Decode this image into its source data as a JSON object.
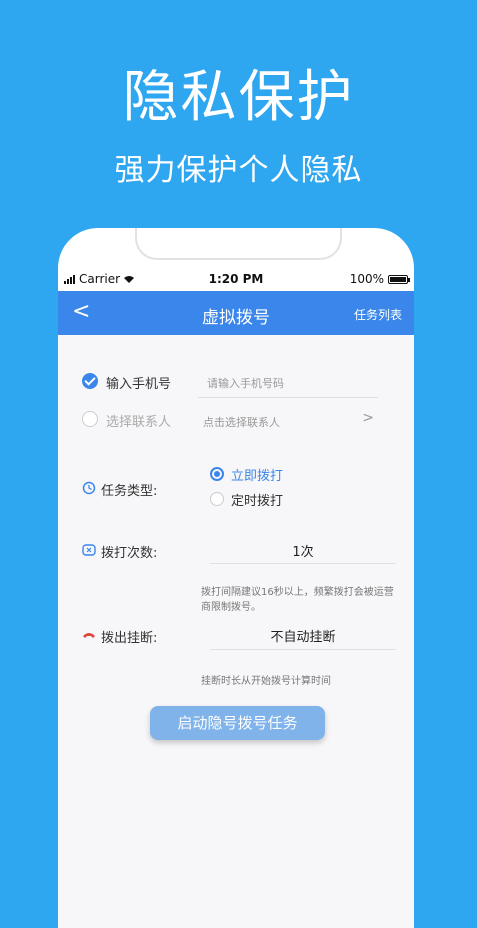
{
  "hero": {
    "title": "隐私保护",
    "subtitle": "强力保护个人隐私"
  },
  "status_bar": {
    "carrier": "Carrier",
    "time": "1:20 PM",
    "battery": "100%"
  },
  "nav": {
    "back": "<",
    "title": "虚拟拨号",
    "right_link": "任务列表"
  },
  "form": {
    "phone": {
      "label": "输入手机号",
      "placeholder": "请输入手机号码",
      "checked": true
    },
    "contact": {
      "label": "选择联系人",
      "placeholder": "点击选择联系人",
      "chevron": ">",
      "checked": false
    },
    "task_type": {
      "label": "任务类型:",
      "options": [
        {
          "label": "立即拨打",
          "selected": true
        },
        {
          "label": "定时拨打",
          "selected": false
        }
      ]
    },
    "dial_count": {
      "label": "拨打次数:",
      "value": "1次",
      "hint": "拨打间隔建议16秒以上，频繁拨打会被运营商限制拨号。"
    },
    "hangup": {
      "label": "拨出挂断:",
      "value": "不自动挂断",
      "hint": "挂断时长从开始拨号计算时间"
    }
  },
  "start_button": "启动隐号拨号任务",
  "colors": {
    "background": "#2ea6f0",
    "accent": "#3b86ea",
    "button": "#7fb3ea",
    "hangup_icon": "#e0443a"
  }
}
